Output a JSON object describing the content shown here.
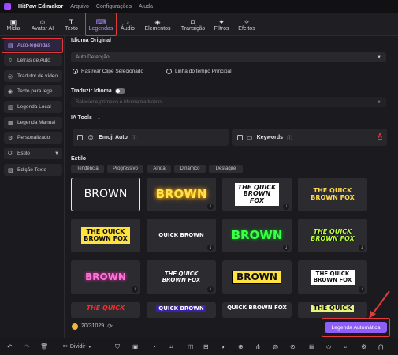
{
  "app": {
    "title": "HitPaw Edimakor"
  },
  "menu": [
    "Arquivo",
    "Configurações",
    "Ajuda"
  ],
  "toolbar": [
    {
      "label": "Mídia",
      "icon": "media-icon",
      "glyph": "▣"
    },
    {
      "label": "Avatar AI",
      "icon": "avatar-icon",
      "glyph": "☺"
    },
    {
      "label": "Texto",
      "icon": "text-icon",
      "glyph": "T"
    },
    {
      "label": "Legendas",
      "icon": "captions-icon",
      "glyph": "⌨",
      "active": true
    },
    {
      "label": "Áudio",
      "icon": "audio-icon",
      "glyph": "♪"
    },
    {
      "label": "Elementos",
      "icon": "elements-icon",
      "glyph": "◈"
    },
    {
      "label": "Transição",
      "icon": "transition-icon",
      "glyph": "⧉"
    },
    {
      "label": "Filtros",
      "icon": "filters-icon",
      "glyph": "✦"
    },
    {
      "label": "Efeitos",
      "icon": "effects-icon",
      "glyph": "✧"
    }
  ],
  "sidebar": {
    "items": [
      {
        "label": "Auto-legendas",
        "icon": "auto-captions-icon",
        "glyph": "▤",
        "active": true
      },
      {
        "label": "Letras de Auto",
        "icon": "lyrics-icon",
        "glyph": "♫"
      },
      {
        "label": "Tradutor de vídeo",
        "icon": "translate-icon",
        "glyph": "◎"
      },
      {
        "label": "Texto para lege...",
        "icon": "text-to-caption-icon",
        "glyph": "◉"
      },
      {
        "label": "Legenda Local",
        "icon": "local-caption-icon",
        "glyph": "▥"
      },
      {
        "label": "Legenda Manual",
        "icon": "manual-caption-icon",
        "glyph": "▦"
      },
      {
        "label": "Personalizado",
        "icon": "custom-icon",
        "glyph": "⚙"
      },
      {
        "label": "Estilo",
        "icon": "style-icon",
        "glyph": "⛭",
        "expandable": true
      },
      {
        "label": "Edição Texto",
        "icon": "text-edit-icon",
        "glyph": "▧"
      }
    ]
  },
  "main": {
    "original_language": {
      "heading": "Idioma Original",
      "value": "Auto Detecção",
      "radio_selected": "Rastrear Clipe Selecionado",
      "radio_other": "Linha do tempo Principal"
    },
    "translate": {
      "heading": "Traduzir Idioma",
      "toggle_on": false,
      "placeholder": "Selecione primeiro o idioma traduzido"
    },
    "ai_tools": {
      "heading": "IA Tools",
      "emoji_label": "Emoji Auto",
      "keywords_label": "Keywords",
      "info_glyph": "ⓘ"
    },
    "style": {
      "heading": "Estilo",
      "tags": [
        "Tendência",
        "Progressivo",
        "Ainda",
        "Dinâmico",
        "Destaque"
      ],
      "tiles": [
        {
          "text": "BROWN",
          "style": "plain-white"
        },
        {
          "text": "BROWN",
          "style": "yellow-glow"
        },
        {
          "text": "THE QUICK BROWN FOX",
          "style": "black-white-box"
        },
        {
          "text": "THE QUICK BROWN FOX",
          "style": "yellow-grey"
        },
        {
          "text": "THE QUICK BROWN FOX",
          "style": "yellow-box"
        },
        {
          "text": "QUICK BROWN",
          "style": "white-bold"
        },
        {
          "text": "BROWN",
          "style": "green-glow"
        },
        {
          "text": "THE QUICK BROWN FOX",
          "style": "lime-italic"
        },
        {
          "text": "BROWN",
          "style": "pink-glow"
        },
        {
          "text": "THE QUICK BROWN FOX",
          "style": "blue-italic"
        },
        {
          "text": "BROWN",
          "style": "yellow-on-black-outline"
        },
        {
          "text": "THE QUICK BROWN FOX",
          "style": "white-box-black"
        },
        {
          "text": "THE QUICK",
          "style": "red-italic"
        },
        {
          "text": "QUICK BROWN",
          "style": "purple-block"
        },
        {
          "text": "QUICK BROWN FOX",
          "style": "white-cut"
        },
        {
          "text": "THE QUICK",
          "style": "yellow-box-cut"
        }
      ]
    }
  },
  "footer": {
    "credits": "20/31029",
    "auto_button": "Legenda Automática"
  },
  "timeline": {
    "split_label": "Dividir"
  },
  "colors": {
    "accent": "#8e5ef7",
    "highlight_frame": "#e23a3a",
    "background": "#1b1b1f"
  }
}
